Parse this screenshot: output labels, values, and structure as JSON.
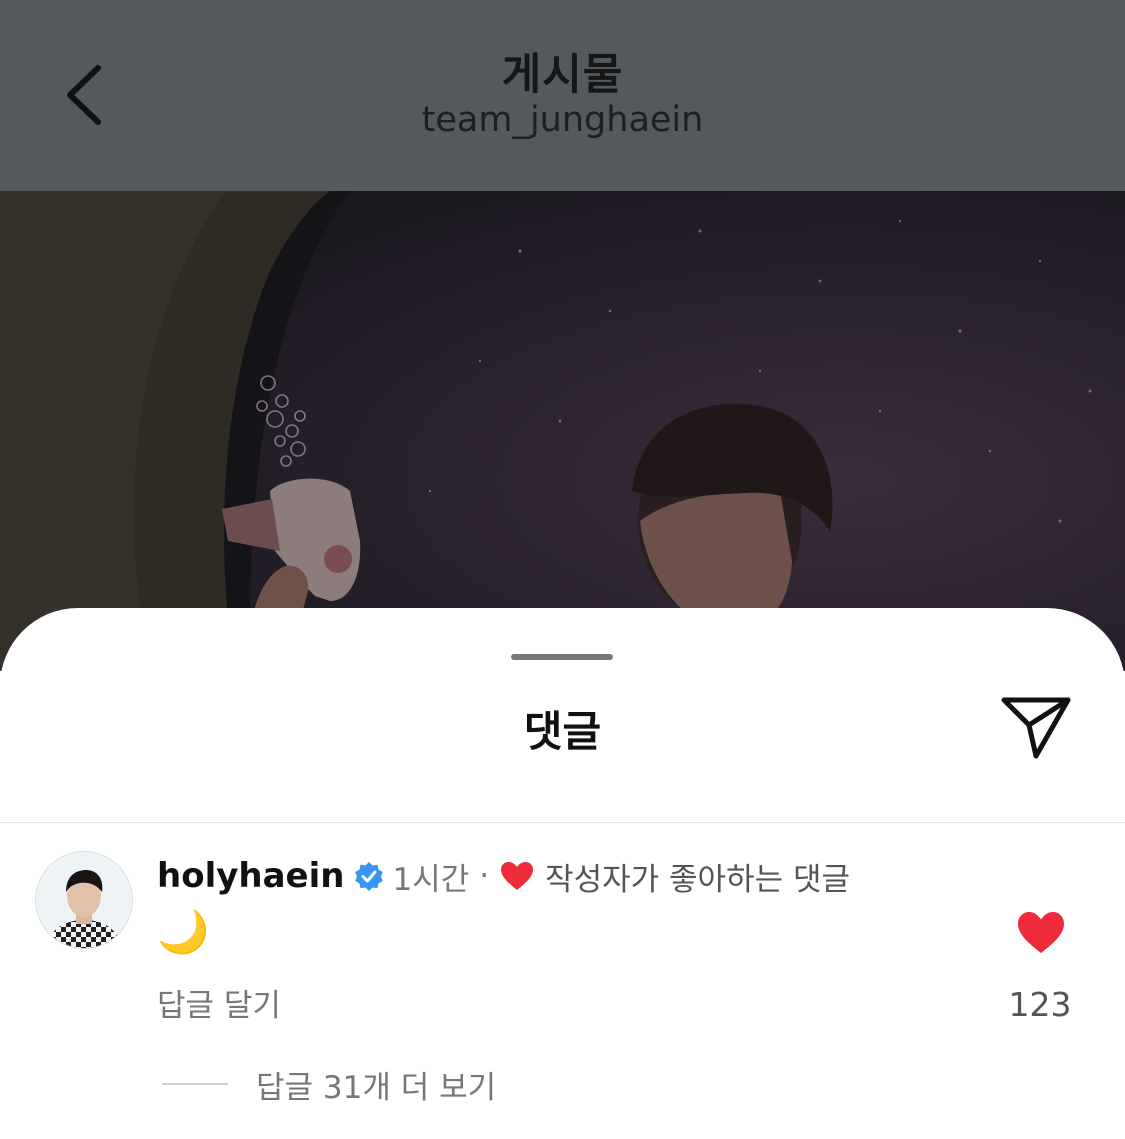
{
  "header": {
    "title": "게시물",
    "subtitle": "team_junghaein",
    "back_icon": "chevron-left-icon"
  },
  "post": {
    "photo_icon": "post-photo"
  },
  "comments_sheet": {
    "title": "댓글",
    "share_icon": "send-icon"
  },
  "comment": {
    "username": "holyhaein",
    "verified_icon": "verified-badge-icon",
    "time": "1시간",
    "separator": "·",
    "liked_by_author_label": "작성자가 좋아하는 댓글",
    "text": "🌙",
    "reply_label": "답글 달기",
    "like_count": "123",
    "view_replies_label": "답글 31개 더 보기"
  },
  "colors": {
    "header_dim": "#55595c",
    "heart_red": "#ee2a3b",
    "verified_blue": "#3797f0",
    "secondary_text": "#777777"
  }
}
